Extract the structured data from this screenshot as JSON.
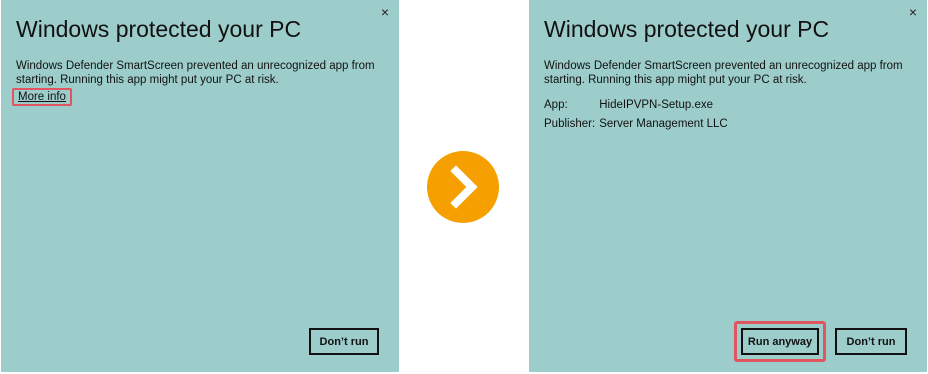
{
  "left_dialog": {
    "title": "Windows protected your PC",
    "close_glyph": "×",
    "message_line1": "Windows Defender SmartScreen prevented an unrecognized app from",
    "message_line2": "starting. Running this app might put your PC at risk.",
    "more_info": "More info",
    "dont_run": "Don’t run"
  },
  "right_dialog": {
    "title": "Windows protected your PC",
    "close_glyph": "×",
    "message_line1": "Windows Defender SmartScreen prevented an unrecognized app from",
    "message_line2": "starting. Running this app might put your PC at risk.",
    "app_label": "App:",
    "app_value": "HideIPVPN-Setup.exe",
    "publisher_label": "Publisher:",
    "publisher_value": "Server Management LLC",
    "run_anyway": "Run anyway",
    "dont_run": "Don’t run"
  },
  "colors": {
    "dialog_bg": "#9dcdca",
    "highlight": "#e05560",
    "arrow_circle": "#f5a000"
  },
  "icons": {
    "arrow": "chevron-right-icon",
    "close": "close-icon"
  }
}
